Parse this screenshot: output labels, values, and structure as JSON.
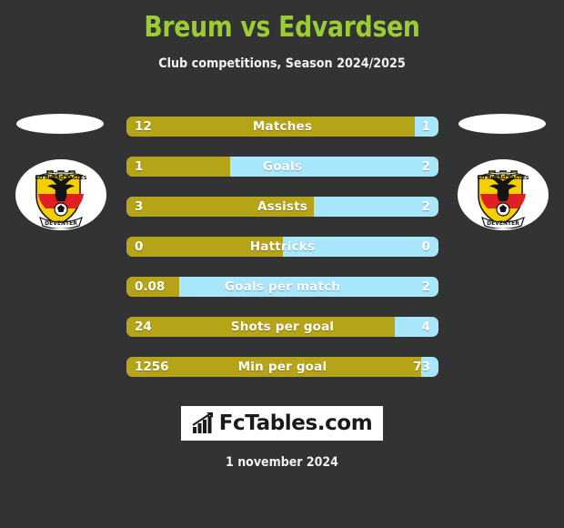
{
  "header": {
    "title": "Breum vs Edvardsen",
    "subtitle": "Club competitions, Season 2024/2025",
    "title_color": "#9bcc33"
  },
  "colors": {
    "background": "#333333",
    "home_bar": "#b5a318",
    "away_bar": "#a8e7fb",
    "value_text": "#ffffff"
  },
  "teams": {
    "home": {
      "crest_name": "go-ahead-eagles-deventer-crest",
      "crest_top_text": "GO AHEAD EAGLES",
      "crest_bottom_text": "DEVENTER"
    },
    "away": {
      "crest_name": "go-ahead-eagles-deventer-crest",
      "crest_top_text": "GO AHEAD EAGLES",
      "crest_bottom_text": "DEVENTER"
    }
  },
  "chart_data": {
    "type": "bar",
    "title": "Breum vs Edvardsen",
    "subtitle": "Club competitions, Season 2024/2025",
    "categories": [
      "Matches",
      "Goals",
      "Assists",
      "Hattricks",
      "Goals per match",
      "Shots per goal",
      "Min per goal"
    ],
    "series": [
      {
        "name": "Breum",
        "values": [
          "12",
          "1",
          "3",
          "0",
          "0.08",
          "24",
          "1256"
        ]
      },
      {
        "name": "Edvardsen",
        "values": [
          "1",
          "2",
          "2",
          "0",
          "2",
          "4",
          "73"
        ]
      }
    ],
    "home_fill_percent": [
      92.3,
      33.3,
      60,
      50,
      17,
      86,
      94.5
    ],
    "legend": "position: none",
    "grid": false
  },
  "rows": [
    {
      "label": "Matches",
      "home": "12",
      "away": "1",
      "home_pct": 92.3
    },
    {
      "label": "Goals",
      "home": "1",
      "away": "2",
      "home_pct": 33.3
    },
    {
      "label": "Assists",
      "home": "3",
      "away": "2",
      "home_pct": 60
    },
    {
      "label": "Hattricks",
      "home": "0",
      "away": "0",
      "home_pct": 50
    },
    {
      "label": "Goals per match",
      "home": "0.08",
      "away": "2",
      "home_pct": 17
    },
    {
      "label": "Shots per goal",
      "home": "24",
      "away": "4",
      "home_pct": 86
    },
    {
      "label": "Min per goal",
      "home": "1256",
      "away": "73",
      "home_pct": 94.5
    }
  ],
  "footer": {
    "logo_text": "FcTables.com",
    "logo_icon": "bar-chart-icon",
    "date": "1 november 2024"
  }
}
